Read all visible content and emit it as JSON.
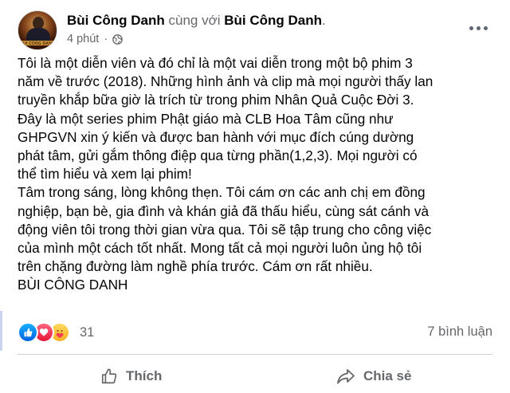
{
  "post": {
    "author": "Bùi Công Danh",
    "with_text": " cùng với ",
    "tagged": "Bùi Công Danh",
    "period": ".",
    "time": "4 phút",
    "dot": "·",
    "avatar_label": "BUI CONG DANH",
    "paragraphs": [
      "Tôi là một diễn viên và đó chỉ là một vai diễn trong một bộ phim 3",
      "năm về trước (2018). Những hình ảnh và clip mà mọi người thấy lan",
      "truyền khắp bữa giờ là trích từ trong phim Nhân Quả Cuộc Đời 3.",
      "Đây là một series phim Phật giáo mà CLB Hoa Tâm cũng như",
      "GHPGVN xin ý kiến và được ban hành với mục đích cúng dường",
      "phát tâm, gửi gắm thông điệp qua từng phần(1,2,3). Mọi người có",
      "thể tìm hiểu và xem lại phim!",
      "Tâm trong sáng, lòng không thẹn. Tôi cám ơn các anh chị em đồng",
      "nghiệp, bạn bè, gia đình và khán giả đã thấu hiểu, cùng sát cánh và",
      "động viên tôi trong thời gian vừa qua. Tôi sẽ tập trung cho công việc",
      "của mình một cách tốt nhất. Mong tất cả mọi người luôn ủng hộ tôi",
      "trên chặng đường làm nghề phía trước. Cám ơn rất nhiều.",
      "BÙI CÔNG DANH"
    ]
  },
  "stats": {
    "reaction_icons": [
      "like-icon",
      "love-icon",
      "care-icon"
    ],
    "reactions_count": "31",
    "comments": "7 bình luận"
  },
  "actions": {
    "like_label": "Thích",
    "share_label": "Chia sẻ"
  },
  "colors": {
    "text": "#050505",
    "secondary": "#65676b",
    "like_blue": "#1877f2",
    "love_red": "#f33e58",
    "care_yellow": "#f7b928"
  }
}
